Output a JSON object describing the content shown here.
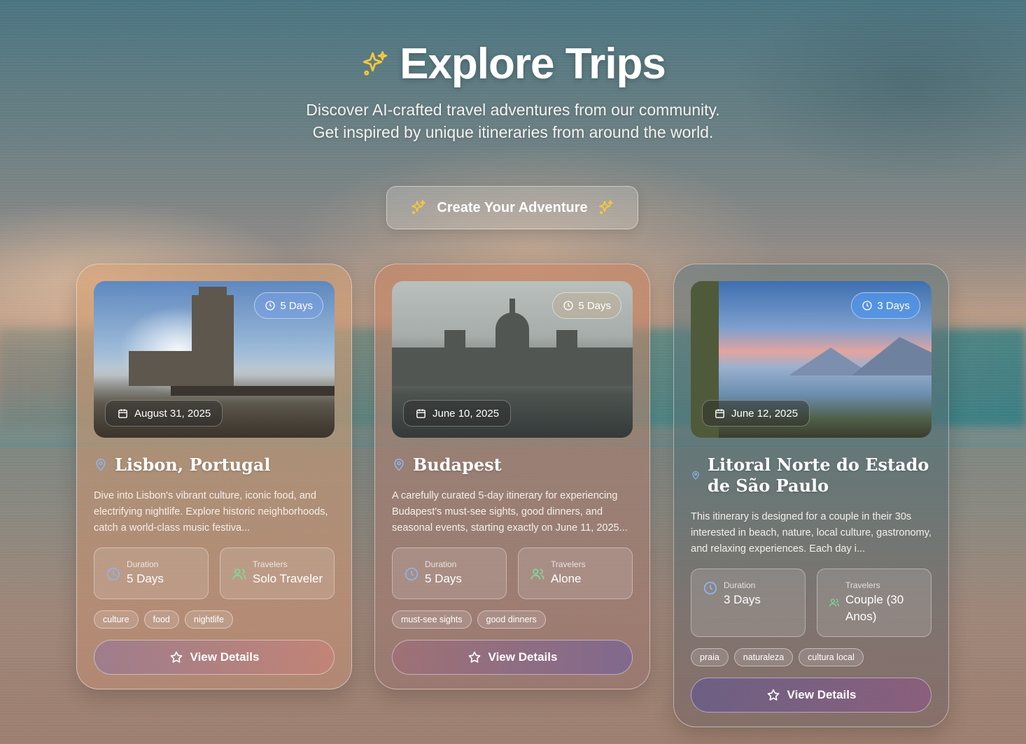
{
  "header": {
    "title": "Explore Trips",
    "subtitle_line1": "Discover AI-crafted travel adventures from our community.",
    "subtitle_line2": "Get inspired by unique itineraries from around the world.",
    "cta_label": "Create Your Adventure"
  },
  "colors": {
    "sparkle": "#f5c83c",
    "pin": "#8fb3e8",
    "duration_icon": "#8fb3e8",
    "travelers_icon": "#7ed99a"
  },
  "trips": [
    {
      "duration_badge": "5 Days",
      "date": "August 31, 2025",
      "destination": "Lisbon, Portugal",
      "description": "Dive into Lisbon's vibrant culture, iconic food, and electrifying nightlife. Explore historic neighborhoods, catch a world-class music festiva...",
      "duration_label": "Duration",
      "duration_value": "5 Days",
      "travelers_label": "Travelers",
      "travelers_value": "Solo Traveler",
      "tags": [
        "culture",
        "food",
        "nightlife"
      ],
      "button_label": "View Details"
    },
    {
      "duration_badge": "5 Days",
      "date": "June 10, 2025",
      "destination": "Budapest",
      "description": "A carefully curated 5-day itinerary for experiencing Budapest's must-see sights, good dinners, and seasonal events, starting exactly on June 11, 2025...",
      "duration_label": "Duration",
      "duration_value": "5 Days",
      "travelers_label": "Travelers",
      "travelers_value": "Alone",
      "tags": [
        "must-see sights",
        "good dinners"
      ],
      "button_label": "View Details"
    },
    {
      "duration_badge": "3 Days",
      "date": "June 12, 2025",
      "destination": "Litoral Norte do Estado de São Paulo",
      "description": "This itinerary is designed for a couple in their 30s interested in beach, nature, local culture, gastronomy, and relaxing experiences. Each day i...",
      "duration_label": "Duration",
      "duration_value": "3 Days",
      "travelers_label": "Travelers",
      "travelers_value": "Couple (30 Anos)",
      "tags": [
        "praia",
        "naturaleza",
        "cultura local"
      ],
      "button_label": "View Details"
    }
  ]
}
